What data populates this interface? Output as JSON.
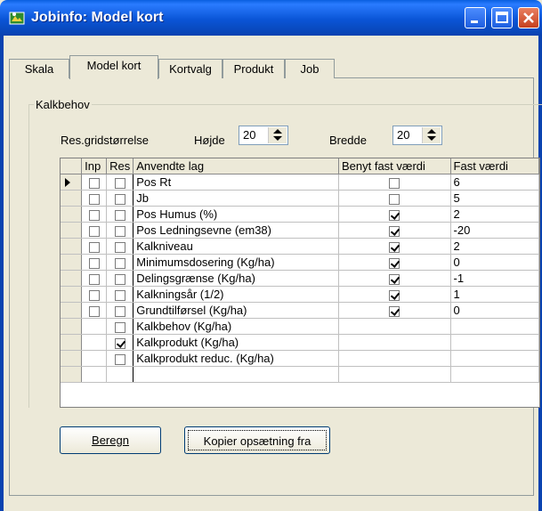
{
  "window": {
    "title": "Jobinfo: Model kort",
    "icon": "app-icon",
    "controls": [
      "minimize-icon",
      "maximize-icon",
      "close-icon"
    ]
  },
  "tabs": [
    {
      "label": "Skala",
      "active": false
    },
    {
      "label": "Model kort",
      "active": true
    },
    {
      "label": "Kortvalg",
      "active": false
    },
    {
      "label": "Produkt",
      "active": false
    },
    {
      "label": "Job",
      "active": false
    }
  ],
  "group": {
    "title": "Kalkbehov",
    "res_label": "Res.gridstørrelse",
    "height_label": "Højde",
    "height_value": "20",
    "width_label": "Bredde",
    "width_value": "20"
  },
  "grid": {
    "headers": [
      "Inp",
      "Res",
      "Anvendte lag",
      "Benyt fast værdi",
      "Fast værdi"
    ],
    "rows": [
      {
        "inp": false,
        "res": false,
        "layer": "Pos Rt",
        "use_fixed": false,
        "fixed": "6",
        "current": true
      },
      {
        "inp": false,
        "res": false,
        "layer": "Jb",
        "use_fixed": false,
        "fixed": "5",
        "current": false
      },
      {
        "inp": false,
        "res": false,
        "layer": "Pos Humus (%)",
        "use_fixed": true,
        "fixed": "2",
        "current": false
      },
      {
        "inp": false,
        "res": false,
        "layer": "Pos Ledningsevne (em38)",
        "use_fixed": true,
        "fixed": "-20",
        "current": false
      },
      {
        "inp": false,
        "res": false,
        "layer": "Kalkniveau",
        "use_fixed": true,
        "fixed": "2",
        "current": false
      },
      {
        "inp": false,
        "res": false,
        "layer": "Minimumsdosering (Kg/ha)",
        "use_fixed": true,
        "fixed": "0",
        "current": false
      },
      {
        "inp": false,
        "res": false,
        "layer": "Delingsgrænse (Kg/ha)",
        "use_fixed": true,
        "fixed": "-1",
        "current": false
      },
      {
        "inp": false,
        "res": false,
        "layer": "Kalkningsår (1/2)",
        "use_fixed": true,
        "fixed": "1",
        "current": false
      },
      {
        "inp": false,
        "res": false,
        "layer": "Grundtilførsel (Kg/ha)",
        "use_fixed": true,
        "fixed": "0",
        "current": false
      },
      {
        "inp": null,
        "res": false,
        "layer": "Kalkbehov (Kg/ha)",
        "use_fixed": null,
        "fixed": "",
        "current": false
      },
      {
        "inp": null,
        "res": true,
        "layer": "Kalkprodukt (Kg/ha)",
        "use_fixed": null,
        "fixed": "",
        "current": false
      },
      {
        "inp": null,
        "res": false,
        "layer": "Kalkprodukt reduc. (Kg/ha)",
        "use_fixed": null,
        "fixed": "",
        "current": false
      }
    ]
  },
  "buttons": {
    "calc": "Beregn",
    "copy": "Kopier opsætning fra"
  }
}
